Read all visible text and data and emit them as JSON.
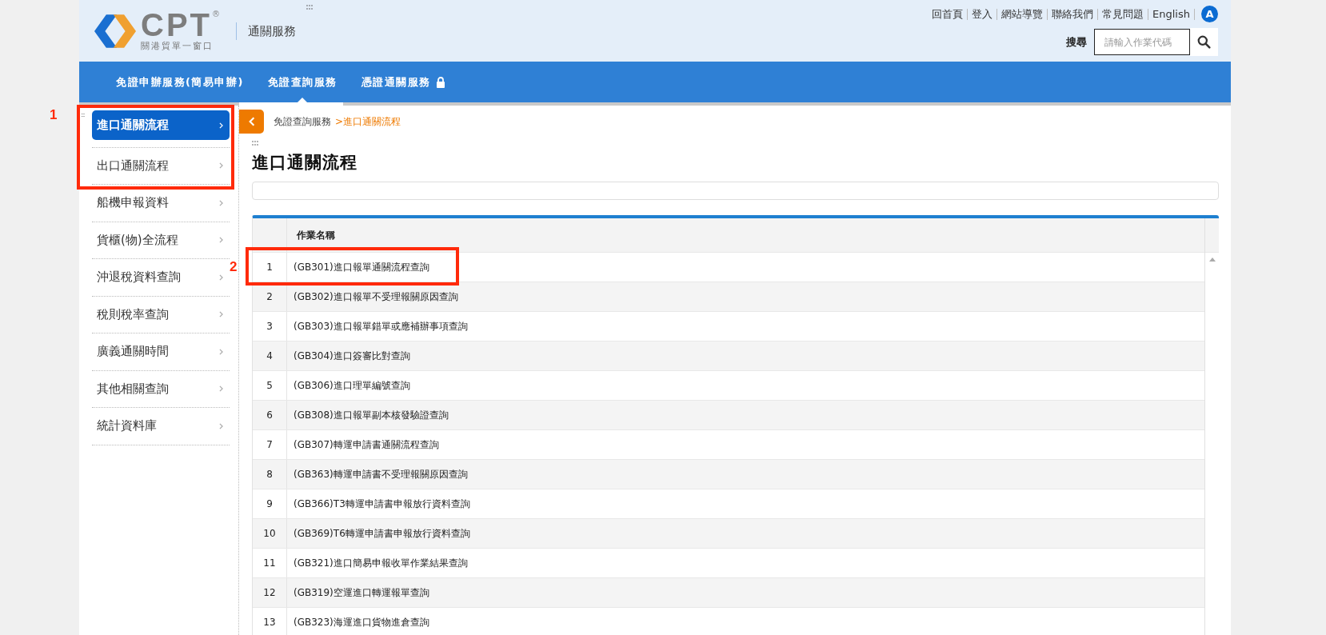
{
  "logo": {
    "mark": "CPT",
    "registered": "®",
    "subtitle": "關港貿單一窗口"
  },
  "site_title": "通關服務",
  "top_links": [
    {
      "label": "回首頁"
    },
    {
      "label": "登入"
    },
    {
      "label": "網站導覽"
    },
    {
      "label": "聯絡我們"
    },
    {
      "label": "常見問題"
    },
    {
      "label": "English"
    }
  ],
  "accessibility_badge": "A",
  "search": {
    "label": "搜尋",
    "placeholder": "請輸入作業代碼"
  },
  "nav_tabs": [
    {
      "label": "免證申辦服務(簡易申辦)",
      "selected": false,
      "locked": false
    },
    {
      "label": "免證查詢服務",
      "selected": true,
      "locked": false
    },
    {
      "label": "憑證通關服務",
      "selected": false,
      "locked": true
    }
  ],
  "sidebar": {
    "items": [
      {
        "label": "進口通關流程",
        "selected": true
      },
      {
        "label": "出口通關流程",
        "selected": false
      },
      {
        "label": "船機申報資料",
        "selected": false
      },
      {
        "label": "貨櫃(物)全流程",
        "selected": false
      },
      {
        "label": "沖退稅資料查詢",
        "selected": false
      },
      {
        "label": "稅則稅率查詢",
        "selected": false
      },
      {
        "label": "廣義通關時間",
        "selected": false
      },
      {
        "label": "其他相關查詢",
        "selected": false
      },
      {
        "label": "統計資料庫",
        "selected": false
      }
    ]
  },
  "breadcrumb": [
    {
      "label": "免證查詢服務",
      "current": false
    },
    {
      "label": ">進口通關流程",
      "current": true
    }
  ],
  "page_title": "進口通關流程",
  "table": {
    "columns": [
      "",
      "作業名稱"
    ],
    "rows": [
      [
        "1",
        "(GB301)進口報單通關流程查詢"
      ],
      [
        "2",
        "(GB302)進口報單不受理報關原因查詢"
      ],
      [
        "3",
        "(GB303)進口報單錯單或應補辦事項查詢"
      ],
      [
        "4",
        "(GB304)進口簽審比對查詢"
      ],
      [
        "5",
        "(GB306)進口理單編號查詢"
      ],
      [
        "6",
        "(GB308)進口報單副本核發驗證查詢"
      ],
      [
        "7",
        "(GB307)轉運申請書通關流程查詢"
      ],
      [
        "8",
        "(GB363)轉運申請書不受理報關原因查詢"
      ],
      [
        "9",
        "(GB366)T3轉運申請書申報放行資料查詢"
      ],
      [
        "10",
        "(GB369)T6轉運申請書申報放行資料查詢"
      ],
      [
        "11",
        "(GB321)進口簡易申報收單作業結果查詢"
      ],
      [
        "12",
        "(GB319)空運進口轉運報單查詢"
      ],
      [
        "13",
        "(GB323)海運進口貨物進倉查詢"
      ]
    ]
  },
  "annotations": [
    {
      "label": "1"
    },
    {
      "label": "2"
    }
  ]
}
